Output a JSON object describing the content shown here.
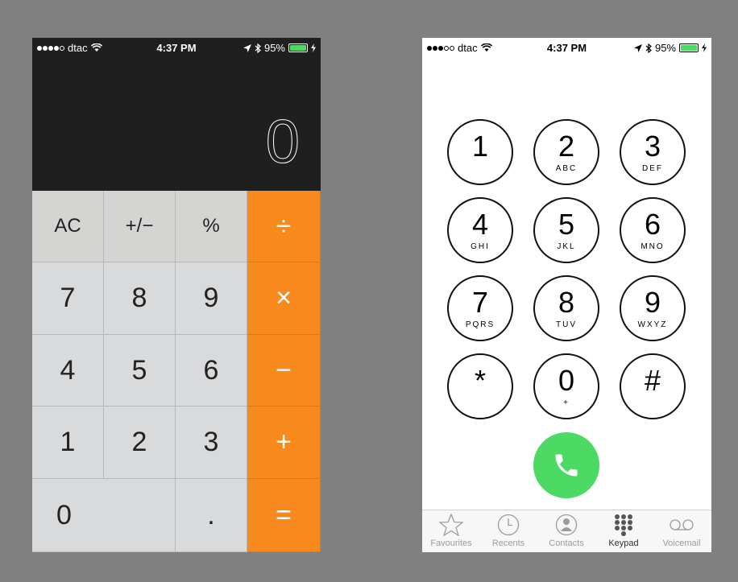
{
  "status_bar": {
    "carrier": "dtac",
    "time": "4:37 PM",
    "battery": "95%",
    "signal_strength": 4,
    "signal_max": 5
  },
  "calculator": {
    "display": "0",
    "keys": {
      "ac": "AC",
      "plus_minus": "+/−",
      "percent": "%",
      "divide": "÷",
      "seven": "7",
      "eight": "8",
      "nine": "9",
      "multiply": "×",
      "four": "4",
      "five": "5",
      "six": "6",
      "minus": "−",
      "one": "1",
      "two": "2",
      "three": "3",
      "plus": "+",
      "zero": "0",
      "decimal": ".",
      "equals": "="
    },
    "colors": {
      "operator": "#f7891d",
      "function": "#d4d4d2",
      "number": "#d9dadb",
      "display_bg": "#1f1f1f"
    }
  },
  "dialer": {
    "keys": [
      {
        "digit": "1",
        "letters": ""
      },
      {
        "digit": "2",
        "letters": "ABC"
      },
      {
        "digit": "3",
        "letters": "DEF"
      },
      {
        "digit": "4",
        "letters": "GHI"
      },
      {
        "digit": "5",
        "letters": "JKL"
      },
      {
        "digit": "6",
        "letters": "MNO"
      },
      {
        "digit": "7",
        "letters": "PQRS"
      },
      {
        "digit": "8",
        "letters": "TUV"
      },
      {
        "digit": "9",
        "letters": "WXYZ"
      },
      {
        "digit": "*",
        "letters": ""
      },
      {
        "digit": "0",
        "letters": "+"
      },
      {
        "digit": "#",
        "letters": ""
      }
    ],
    "call_icon": "phone-icon",
    "call_color": "#4cd964",
    "tabs": [
      {
        "label": "Favourites",
        "icon": "star-icon"
      },
      {
        "label": "Recents",
        "icon": "clock-icon"
      },
      {
        "label": "Contacts",
        "icon": "contact-icon"
      },
      {
        "label": "Keypad",
        "icon": "keypad-icon",
        "active": true
      },
      {
        "label": "Voicemail",
        "icon": "voicemail-icon"
      }
    ]
  }
}
